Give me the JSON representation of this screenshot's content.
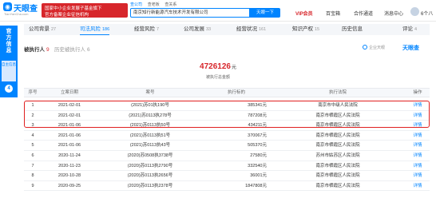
{
  "header": {
    "logo_name": "天眼查",
    "logo_domain": "TianYanCha.com",
    "promo_line1": "国家中小企业发展子基金旗下",
    "promo_line2": "官方备案企业征信机构",
    "search_tabs": [
      "查公司",
      "查老板",
      "查关系"
    ],
    "search_value": "南京知行新能源汽车技术开发有限公司",
    "search_button": "天眼一下",
    "nav": {
      "vip": "VIP会员",
      "business": "百宝箱",
      "cooperation": "合作通道",
      "messages": "消息中心",
      "user": "6个八"
    }
  },
  "left_badge": {
    "title": "官方信息",
    "sub": "自主信息",
    "count": "4"
  },
  "tabs": [
    {
      "label": "公司背景",
      "count": "27"
    },
    {
      "label": "司法风险",
      "count": "186"
    },
    {
      "label": "经营风险",
      "count": "7"
    },
    {
      "label": "公司发展",
      "count": "33"
    },
    {
      "label": "经营状况",
      "count": "161"
    },
    {
      "label": "知识产权",
      "count": "15"
    },
    {
      "label": "历史信息",
      "count": ""
    },
    {
      "label": "评论",
      "count": "4"
    }
  ],
  "subtabs": {
    "current": {
      "label": "被执行人",
      "count": "9"
    },
    "history": {
      "label": "历史被执行人",
      "count": "6"
    }
  },
  "follow_label": "企业天眼",
  "wm_logo": "天眼查",
  "summary": {
    "amount": "4726126",
    "unit": "元",
    "label": "被执行总金额"
  },
  "table": {
    "headers": [
      "序号",
      "立案日期",
      "案号",
      "执行标的",
      "执行法院",
      "操作"
    ],
    "rows": [
      {
        "idx": "1",
        "date": "2021-02-01",
        "case": "(2021)苏01执190号",
        "amount": "385341元",
        "court": "南京市中级人民法院",
        "op": "详情"
      },
      {
        "idx": "2",
        "date": "2021-02-01",
        "case": "(2021)苏0113执278号",
        "amount": "787208元",
        "court": "南京市栖霞区人民法院",
        "op": "详情"
      },
      {
        "idx": "3",
        "date": "2021-01-06",
        "case": "(2021)苏0113执50号",
        "amount": "434211元",
        "court": "南京市栖霞区人民法院",
        "op": "详情"
      },
      {
        "idx": "4",
        "date": "2021-01-06",
        "case": "(2021)苏0113执51号",
        "amount": "370067元",
        "court": "南京市栖霞区人民法院",
        "op": "详情"
      },
      {
        "idx": "5",
        "date": "2021-01-06",
        "case": "(2021)苏0113执43号",
        "amount": "505370元",
        "court": "南京市栖霞区人民法院",
        "op": "详情"
      },
      {
        "idx": "6",
        "date": "2020-11-24",
        "case": "(2020)苏0508执3738号",
        "amount": "27580元",
        "court": "苏州市姑苏区人民法院",
        "op": "详情"
      },
      {
        "idx": "7",
        "date": "2020-11-23",
        "case": "(2020)苏0113执2790号",
        "amount": "332540元",
        "court": "南京市栖霞区人民法院",
        "op": "详情"
      },
      {
        "idx": "8",
        "date": "2020-10-28",
        "case": "(2020)苏0113执2656号",
        "amount": "36001元",
        "court": "南京市栖霞区人民法院",
        "op": "详情"
      },
      {
        "idx": "9",
        "date": "2020-09-25",
        "case": "(2020)苏0113执2378号",
        "amount": "1847808元",
        "court": "南京市栖霞区人民法院",
        "op": "详情"
      }
    ]
  },
  "colors": {
    "brand": "#0084ff",
    "alert": "#d7262b",
    "highlight_border": "#e02020"
  }
}
